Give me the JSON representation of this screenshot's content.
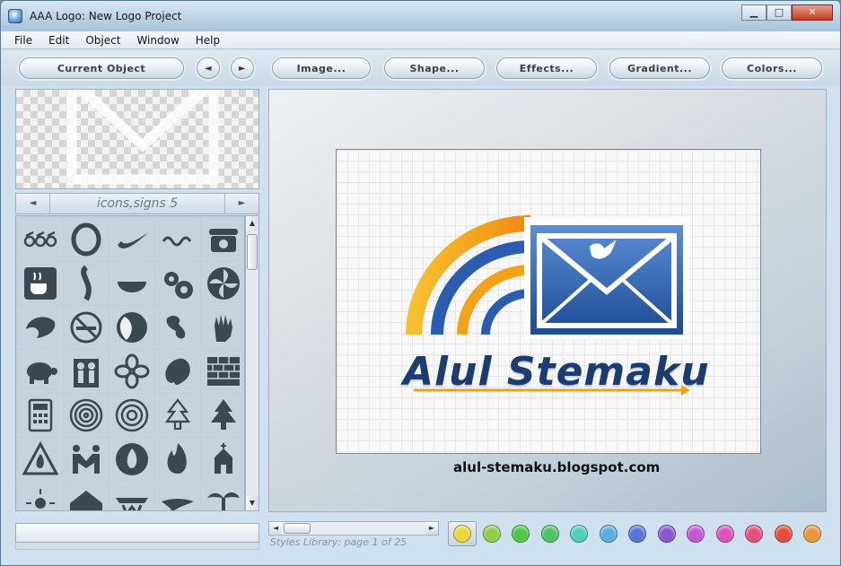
{
  "window": {
    "title": "AAA Logo: New Logo Project",
    "controls": {
      "minimize": "▁",
      "maximize": "□",
      "close": "✕"
    }
  },
  "menu": [
    "File",
    "Edit",
    "Object",
    "Window",
    "Help"
  ],
  "toolbar": {
    "current_object": "Current Object",
    "prev": "◄",
    "next": "►",
    "image": "Image...",
    "shape": "Shape...",
    "effects": "Effects...",
    "gradient": "Gradient...",
    "colors": "Colors..."
  },
  "library": {
    "title": "icons,signs 5",
    "prev_arrow": "◄",
    "next_arrow": "►",
    "icons": [
      "people-chain-icon",
      "ring-swirl-icon",
      "swoosh-icon",
      "squiggle-icon",
      "telephone-icon",
      "coffee-cup-icon",
      "s-curve-icon",
      "bowl-icon",
      "gears-icon",
      "pinwheel-icon",
      "wave-icon",
      "no-smoking-icon",
      "moon-globe-icon",
      "earth-icon",
      "hand-icon",
      "turtle-icon",
      "family-icon",
      "flower-icon",
      "tree-blob-icon",
      "brick-wall-icon",
      "calculator-icon",
      "spiral-icon",
      "concentric-spiral-icon",
      "christmas-tree-icon",
      "pine-tree-icon",
      "warning-fire-icon",
      "handshake-icon",
      "fire-circle-icon",
      "flame-icon",
      "church-icon",
      "sun-icon",
      "house-icon",
      "wonder-logo-icon",
      "wing-icon",
      "palm-tree-icon"
    ]
  },
  "canvas": {
    "brand": "Alul Stemaku"
  },
  "watermark": "alul-stemaku.blogspot.com",
  "status": {
    "styles_text": "Styles Library: page 1 of 25"
  },
  "colors": {
    "swatches": [
      "#e6d93a",
      "#8ed04a",
      "#4fc84a",
      "#4ec36a",
      "#4fd0b8",
      "#5aaee0",
      "#5872d8",
      "#8a55d0",
      "#c25ad6",
      "#e050c0",
      "#e8507a",
      "#e84a3c",
      "#e8963a"
    ],
    "selected_index": 0,
    "brand_blue": "#1a3c70",
    "arc_orange": "#f2a013",
    "arc_blue": "#2c5fae"
  }
}
